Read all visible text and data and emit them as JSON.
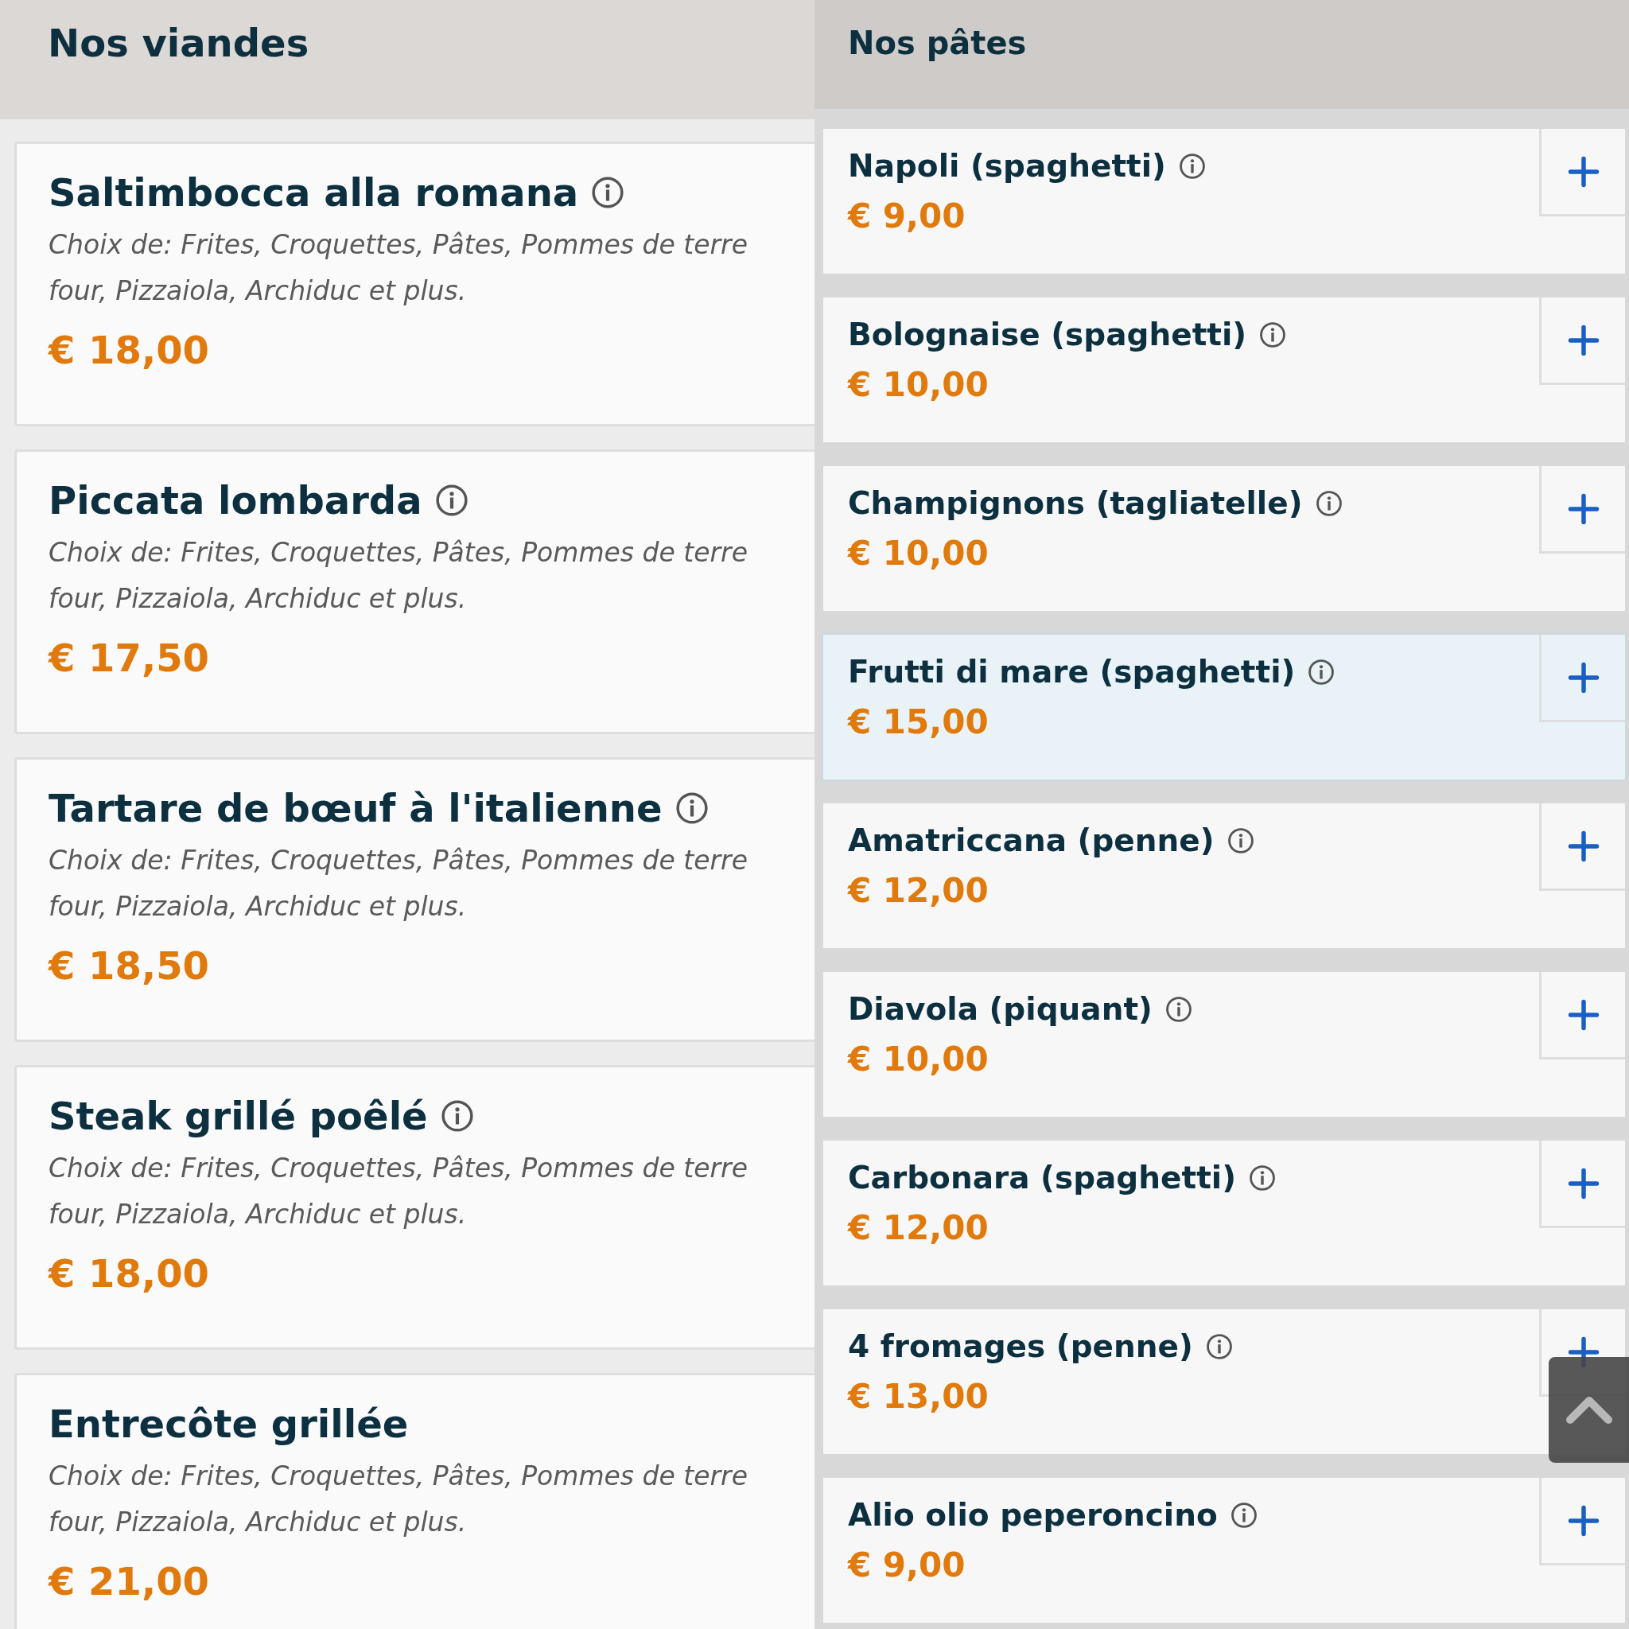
{
  "meats": {
    "title": "Nos viandes",
    "items": [
      {
        "name": "Saltimbocca alla romana",
        "info": true,
        "description": [
          "Choix de: Frites, Croquettes, Pâtes, Pommes de terre",
          "four, Pizzaiola, Archiduc et plus."
        ],
        "price": "€ 18,00"
      },
      {
        "name": "Piccata lombarda",
        "info": true,
        "description": [
          "Choix de: Frites, Croquettes, Pâtes, Pommes de terre",
          "four, Pizzaiola, Archiduc et plus."
        ],
        "price": "€ 17,50"
      },
      {
        "name": "Tartare de bœuf à l'italienne",
        "info": true,
        "description": [
          "Choix de: Frites, Croquettes, Pâtes, Pommes de terre",
          "four, Pizzaiola, Archiduc et plus."
        ],
        "price": "€ 18,50"
      },
      {
        "name": "Steak grillé poêlé",
        "info": true,
        "description": [
          "Choix de: Frites, Croquettes, Pâtes, Pommes de terre",
          "four, Pizzaiola, Archiduc et plus."
        ],
        "price": "€ 18,00"
      },
      {
        "name": "Entrecôte grillée",
        "info": false,
        "description": [
          "Choix de: Frites, Croquettes, Pâtes, Pommes de terre",
          "four, Pizzaiola, Archiduc et plus."
        ],
        "price": "€ 21,00"
      }
    ]
  },
  "pastas": {
    "title": "Nos pâtes",
    "items": [
      {
        "name": "Napoli (spaghetti)",
        "info": true,
        "price": "€ 9,00",
        "selected": false
      },
      {
        "name": "Bolognaise (spaghetti)",
        "info": true,
        "price": "€ 10,00",
        "selected": false
      },
      {
        "name": "Champignons (tagliatelle)",
        "info": true,
        "price": "€ 10,00",
        "selected": false
      },
      {
        "name": "Frutti di mare (spaghetti)",
        "info": true,
        "price": "€ 15,00",
        "selected": true
      },
      {
        "name": "Amatriccana (penne)",
        "info": true,
        "price": "€ 12,00",
        "selected": false
      },
      {
        "name": "Diavola (piquant)",
        "info": true,
        "price": "€ 10,00",
        "selected": false
      },
      {
        "name": "Carbonara (spaghetti)",
        "info": true,
        "price": "€ 12,00",
        "selected": false
      },
      {
        "name": "4 fromages (penne)",
        "info": true,
        "price": "€ 13,00",
        "selected": false
      },
      {
        "name": "Alio olio peperoncino",
        "info": true,
        "price": "€ 9,00",
        "selected": false
      }
    ]
  }
}
